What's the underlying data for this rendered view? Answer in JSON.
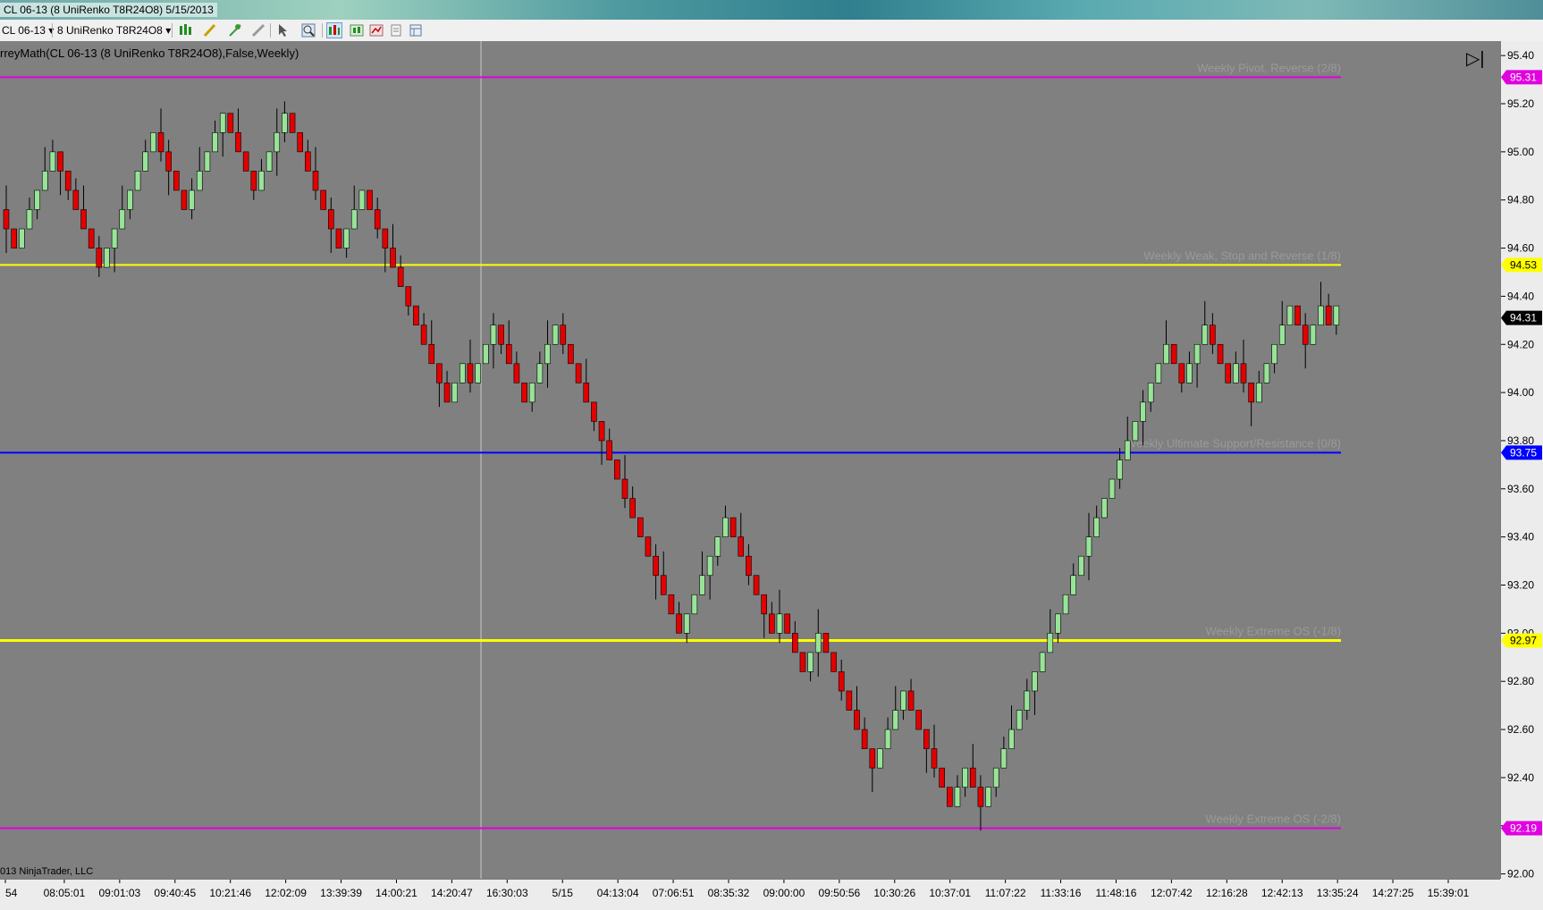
{
  "window": {
    "title": "CL 06-13 (8 UniRenko T8R24O8)  5/15/2013"
  },
  "toolbar": {
    "instrument": "CL 06-13",
    "bar_type": "8 UniRenko T8R24O8",
    "icons": [
      "bar-style-icon",
      "draw-pencil-icon",
      "draw-tools-icon",
      "eraser-icon",
      "cursor-icon",
      "zoom-icon",
      "data-box-icon",
      "indicators-icon",
      "strategies-icon",
      "properties-icon",
      "template-icon"
    ]
  },
  "chart": {
    "indicator_label": "rreyMath(CL 06-13 (8 UniRenko T8R24O8),False,Weekly)",
    "copyright": "013 NinjaTrader, LLC",
    "end_button": "▷|",
    "colors": {
      "background": "#808080",
      "up_candle": "#98e398",
      "down_candle": "#e30000",
      "wick": "#000000"
    }
  },
  "chart_data": {
    "type": "candlestick",
    "ylim": [
      91.98,
      95.46
    ],
    "y_ticks": [
      92.0,
      92.2,
      92.4,
      92.6,
      92.8,
      93.0,
      93.2,
      93.4,
      93.6,
      93.8,
      94.0,
      94.2,
      94.4,
      94.6,
      94.8,
      95.0,
      95.2,
      95.4
    ],
    "x_tick_labels": [
      "54",
      "08:05:01",
      "09:01:03",
      "09:40:45",
      "10:21:46",
      "12:02:09",
      "13:39:39",
      "14:00:21",
      "14:20:47",
      "16:30:03",
      "5/15",
      "04:13:04",
      "07:06:51",
      "08:35:32",
      "09:00:00",
      "09:50:56",
      "10:30:26",
      "10:37:01",
      "11:07:22",
      "11:33:16",
      "11:48:16",
      "12:07:42",
      "12:16:28",
      "12:42:13",
      "13:35:24",
      "14:27:25",
      "15:39:01"
    ],
    "current_price": 94.31,
    "levels": [
      {
        "value": 95.31,
        "label": "Weekly Pivot, Reverse (2/8)",
        "color": "#e000e0"
      },
      {
        "value": 94.53,
        "label": "Weekly Weak, Stop and Reverse (1/8)",
        "color": "#ffff00"
      },
      {
        "value": 93.75,
        "label": "Weekly Ultimate Support/Resistance (0/8)",
        "color": "#0000ff"
      },
      {
        "value": 92.97,
        "label": "Weekly Extreme OS (-1/8)",
        "color": "#ffff00"
      },
      {
        "value": 92.19,
        "label": "Weekly Extreme OS (-2/8)",
        "color": "#e000e0"
      }
    ],
    "opens": [
      94.76,
      94.68,
      94.6,
      94.68,
      94.76,
      94.84,
      94.92,
      95.0,
      94.92,
      94.84,
      94.76,
      94.68,
      94.6,
      94.52,
      94.6,
      94.68,
      94.76,
      94.84,
      94.92,
      95.0,
      95.08,
      95.0,
      94.92,
      94.84,
      94.76,
      94.84,
      94.92,
      95.0,
      95.08,
      95.16,
      95.08,
      95.0,
      94.92,
      94.84,
      94.92,
      95.0,
      95.08,
      95.16,
      95.08,
      95.0,
      94.92,
      94.84,
      94.76,
      94.68,
      94.6,
      94.68,
      94.76,
      94.84,
      94.76,
      94.68,
      94.6,
      94.52,
      94.44,
      94.36,
      94.28,
      94.2,
      94.12,
      94.04,
      93.96,
      94.04,
      94.12,
      94.04,
      94.12,
      94.2,
      94.28,
      94.2,
      94.12,
      94.04,
      93.96,
      94.04,
      94.12,
      94.2,
      94.28,
      94.2,
      94.12,
      94.04,
      93.96,
      93.88,
      93.8,
      93.72,
      93.64,
      93.56,
      93.48,
      93.4,
      93.32,
      93.24,
      93.16,
      93.08,
      93.0,
      93.08,
      93.16,
      93.24,
      93.32,
      93.4,
      93.48,
      93.4,
      93.32,
      93.24,
      93.16,
      93.08,
      93.0,
      93.08,
      93.0,
      92.92,
      92.84,
      92.92,
      93.0,
      92.92,
      92.84,
      92.76,
      92.68,
      92.6,
      92.52,
      92.44,
      92.52,
      92.6,
      92.68,
      92.76,
      92.68,
      92.6,
      92.52,
      92.44,
      92.36,
      92.28,
      92.36,
      92.44,
      92.36,
      92.28,
      92.36,
      92.44,
      92.52,
      92.6,
      92.68,
      92.76,
      92.84,
      92.92,
      93.0,
      93.08,
      93.16,
      93.24,
      93.32,
      93.4,
      93.48,
      93.56,
      93.64,
      93.72,
      93.8,
      93.88,
      93.96,
      94.04,
      94.12,
      94.2,
      94.12,
      94.04,
      94.12,
      94.2,
      94.28,
      94.2,
      94.12,
      94.04,
      94.12,
      94.04,
      93.96,
      94.04,
      94.12,
      94.2,
      94.28,
      94.36,
      94.28,
      94.2,
      94.28,
      94.36,
      94.28
    ],
    "closes": [
      94.68,
      94.6,
      94.68,
      94.76,
      94.84,
      94.92,
      95.0,
      94.92,
      94.84,
      94.76,
      94.68,
      94.6,
      94.52,
      94.6,
      94.68,
      94.76,
      94.84,
      94.92,
      95.0,
      95.08,
      95.0,
      94.92,
      94.84,
      94.76,
      94.84,
      94.92,
      95.0,
      95.08,
      95.16,
      95.08,
      95.0,
      94.92,
      94.84,
      94.92,
      95.0,
      95.08,
      95.16,
      95.08,
      95.0,
      94.92,
      94.84,
      94.76,
      94.68,
      94.6,
      94.68,
      94.76,
      94.84,
      94.76,
      94.68,
      94.6,
      94.52,
      94.44,
      94.36,
      94.28,
      94.2,
      94.12,
      94.04,
      93.96,
      94.04,
      94.12,
      94.04,
      94.12,
      94.2,
      94.28,
      94.2,
      94.12,
      94.04,
      93.96,
      94.04,
      94.12,
      94.2,
      94.28,
      94.2,
      94.12,
      94.04,
      93.96,
      93.88,
      93.8,
      93.72,
      93.64,
      93.56,
      93.48,
      93.4,
      93.32,
      93.24,
      93.16,
      93.08,
      93.0,
      93.08,
      93.16,
      93.24,
      93.32,
      93.4,
      93.48,
      93.4,
      93.32,
      93.24,
      93.16,
      93.08,
      93.0,
      93.08,
      93.0,
      92.92,
      92.84,
      92.92,
      93.0,
      92.92,
      92.84,
      92.76,
      92.68,
      92.6,
      92.52,
      92.44,
      92.52,
      92.6,
      92.68,
      92.76,
      92.68,
      92.6,
      92.52,
      92.44,
      92.36,
      92.28,
      92.36,
      92.44,
      92.36,
      92.28,
      92.36,
      92.44,
      92.52,
      92.6,
      92.68,
      92.76,
      92.84,
      92.92,
      93.0,
      93.08,
      93.16,
      93.24,
      93.32,
      93.4,
      93.48,
      93.56,
      93.64,
      93.72,
      93.8,
      93.88,
      93.96,
      94.04,
      94.12,
      94.2,
      94.12,
      94.04,
      94.12,
      94.2,
      94.28,
      94.2,
      94.12,
      94.04,
      94.12,
      94.04,
      93.96,
      94.04,
      94.12,
      94.2,
      94.28,
      94.36,
      94.28,
      94.2,
      94.28,
      94.36,
      94.28,
      94.36
    ]
  }
}
